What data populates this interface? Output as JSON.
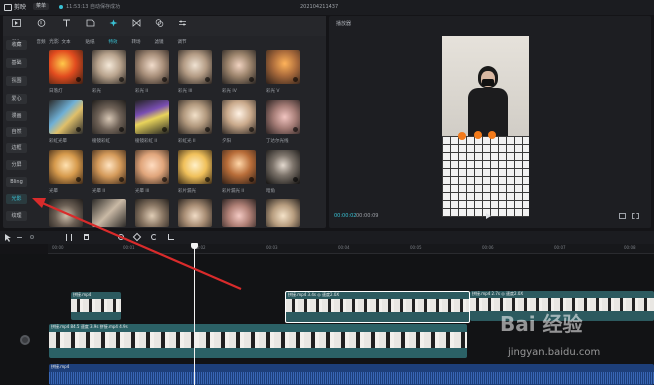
{
  "app": {
    "name": "剪映",
    "menu_button": "菜单",
    "autosave": "11:53:13 自动保存成功",
    "project_title": "202104211437"
  },
  "toolbar": [
    {
      "label": "媒体",
      "icon": "media-icon"
    },
    {
      "label": "音频",
      "icon": "audio-icon"
    },
    {
      "label": "文本",
      "icon": "text-icon"
    },
    {
      "label": "贴纸",
      "icon": "sticker-icon"
    },
    {
      "label": "特效",
      "icon": "effects-icon",
      "active": true
    },
    {
      "label": "转场",
      "icon": "transition-icon"
    },
    {
      "label": "滤镜",
      "icon": "filter-icon"
    },
    {
      "label": "调节",
      "icon": "adjust-icon"
    }
  ],
  "categories": [
    {
      "label": "收藏"
    },
    {
      "label": "基础"
    },
    {
      "label": "氛围"
    },
    {
      "label": "爱心"
    },
    {
      "label": "漫画"
    },
    {
      "label": "自然"
    },
    {
      "label": "边框"
    },
    {
      "label": "分屏"
    },
    {
      "label": "Bling"
    },
    {
      "label": "光影",
      "active": true
    },
    {
      "label": "纹理"
    }
  ],
  "section_title": "光影",
  "effects": [
    {
      "label": "日落灯"
    },
    {
      "label": "彩光"
    },
    {
      "label": "彩光 II"
    },
    {
      "label": "彩光 III"
    },
    {
      "label": "彩光 IV"
    },
    {
      "label": "彩光 V"
    },
    {
      "label": "彩虹光晕"
    },
    {
      "label": "棱镜彩虹"
    },
    {
      "label": "棱镜彩虹 II"
    },
    {
      "label": "彩虹光 II"
    },
    {
      "label": "夕阳"
    },
    {
      "label": "丁达尔光线"
    },
    {
      "label": "光晕"
    },
    {
      "label": "光晕 II"
    },
    {
      "label": "光晕 III"
    },
    {
      "label": "彩片漏光"
    },
    {
      "label": "彩片漏光 II"
    },
    {
      "label": "暗角"
    },
    {
      "label": ""
    },
    {
      "label": ""
    },
    {
      "label": ""
    },
    {
      "label": ""
    },
    {
      "label": ""
    },
    {
      "label": ""
    }
  ],
  "player": {
    "title": "播放器",
    "time_current": "00:00:02",
    "time_total": "00:00:09"
  },
  "ruler_ticks": [
    "00:00",
    "00:01",
    "00:02",
    "00:03",
    "00:04",
    "00:05",
    "00:06",
    "00:07",
    "00:08"
  ],
  "clips": {
    "top_a_label": "拼接.mp4",
    "top_b_label": "拼接.mp4  3.4s  ◎ 速度2.0X",
    "top_c_label": "拼接.mp4  2.7s  ◎ 速度2.0X",
    "main_label": "拼接.mp4  84.5  速度  3.9s  拼接.mp4  4.9s",
    "audio_label": "拼接.mp4"
  },
  "watermark": {
    "brand": "Bai  经验",
    "url": "jingyan.baidu.com"
  },
  "colors": {
    "accent": "#39c0d3",
    "clip_border": "#2c8d98",
    "arrow": "#d92b2b"
  }
}
